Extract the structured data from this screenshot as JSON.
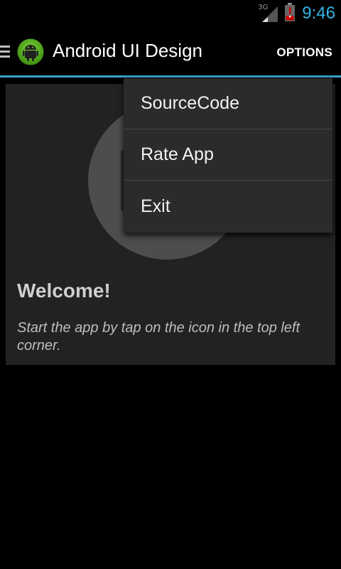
{
  "status_bar": {
    "network": "3G",
    "time": "9:46",
    "icons": [
      "signal-icon",
      "battery-alert-icon"
    ],
    "time_color": "#33b5e5"
  },
  "action_bar": {
    "title": "Android UI Design",
    "options_label": "OPTIONS",
    "icons": [
      "drawer-toggle-icon",
      "android-app-icon"
    ],
    "accent": "#3aa0c8"
  },
  "overflow_menu": {
    "items": [
      {
        "label": "SourceCode"
      },
      {
        "label": "Rate App"
      },
      {
        "label": "Exit"
      }
    ]
  },
  "content": {
    "heading": "Welcome!",
    "description": "Start the app by tap on the icon in the top left corner."
  }
}
